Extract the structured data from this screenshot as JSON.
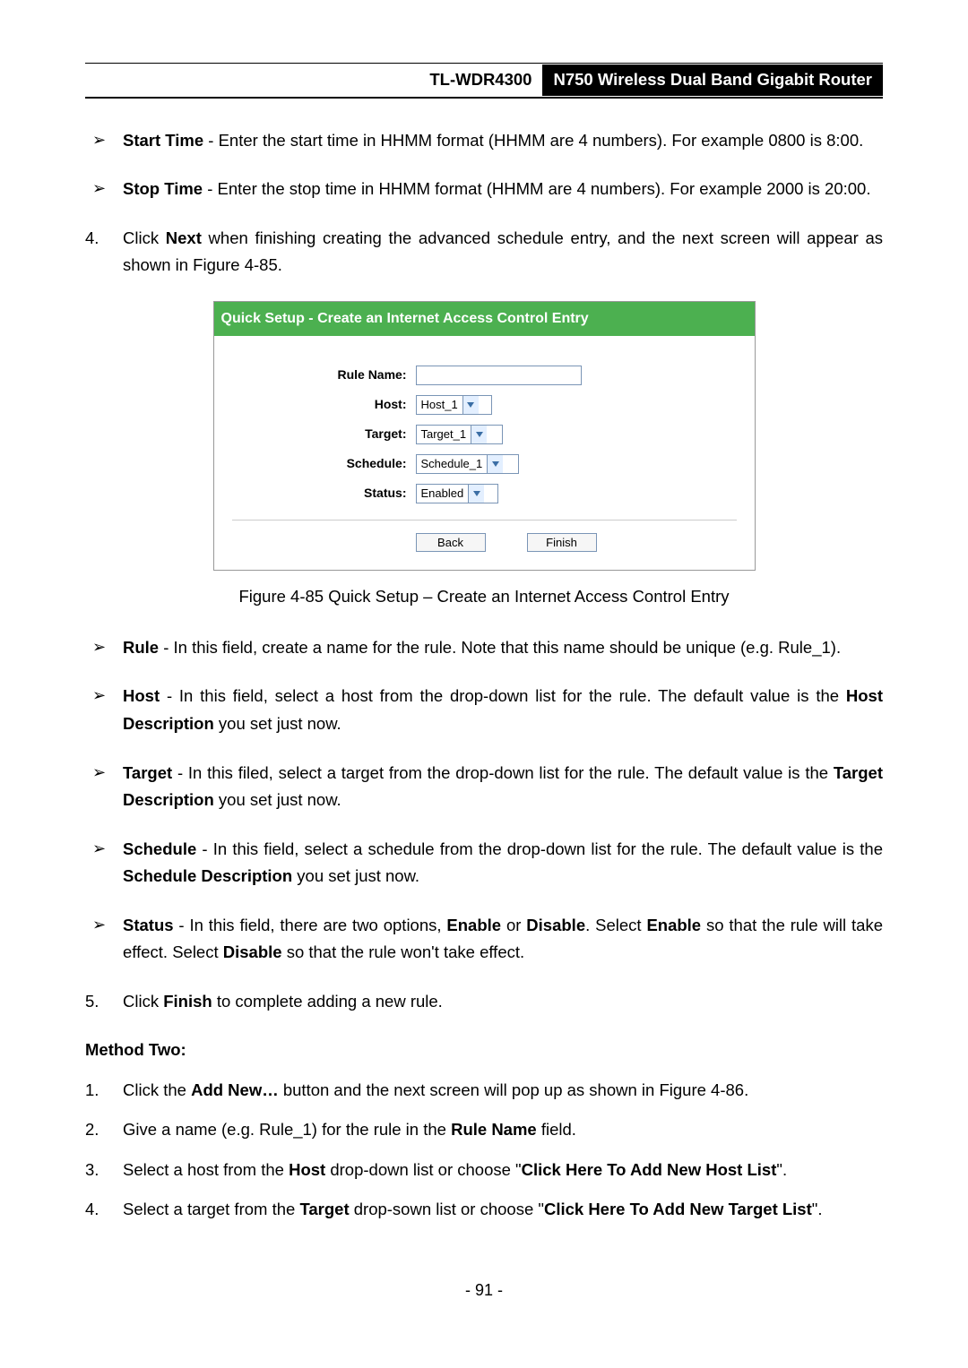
{
  "header": {
    "model": "TL-WDR4300",
    "product": "N750 Wireless Dual Band Gigabit Router"
  },
  "preBullets": [
    {
      "term": "Start Time",
      "rest": " - Enter the start time in HHMM format (HHMM are 4 numbers). For example 0800 is 8:00."
    },
    {
      "term": "Stop Time",
      "rest": " - Enter the stop time in HHMM format (HHMM are 4 numbers). For example 2000 is 20:00."
    }
  ],
  "step4": {
    "num": "4.",
    "pre": "Click ",
    "bold": "Next",
    "post": " when finishing creating the advanced schedule entry, and the next screen will appear as shown in Figure 4-85."
  },
  "figure": {
    "title": "Quick Setup - Create an Internet Access Control Entry",
    "labels": {
      "rule": "Rule Name:",
      "host": "Host:",
      "target": "Target:",
      "schedule": "Schedule:",
      "status": "Status:"
    },
    "values": {
      "rule": "",
      "host": "Host_1",
      "target": "Target_1",
      "schedule": "Schedule_1",
      "status": "Enabled"
    },
    "buttons": {
      "back": "Back",
      "finish": "Finish"
    },
    "caption": "Figure 4-85 Quick Setup – Create an Internet Access Control Entry"
  },
  "postFigBullets": {
    "rule": {
      "term": "Rule",
      "rest": " - In this field, create a name for the rule. Note that this name should be unique (e.g. Rule_1)."
    },
    "hostA": {
      "term": "Host",
      "restA": " - In this field, select a host from the drop-down list for the rule. The default value is the ",
      "bold": "Host Description",
      "restB": " you set just now."
    },
    "target": {
      "term": "Target",
      "restA": " - In this filed, select a target from the drop-down list for the rule. The default value is the ",
      "bold": "Target Description",
      "restB": " you set just now."
    },
    "sched": {
      "term": "Schedule",
      "restA": " - In this field, select a schedule from the drop-down list for the rule. The default value is the ",
      "bold": "Schedule Description",
      "restB": " you set just now."
    },
    "status": {
      "term": "Status",
      "a": " - In this field, there are two options, ",
      "b1": "Enable",
      "c": " or ",
      "b2": "Disable",
      "d": ". Select ",
      "b3": "Enable",
      "e": " so that the rule will take effect. Select ",
      "b4": "Disable",
      "f": " so that the rule won't take effect."
    }
  },
  "step5": {
    "num": "5.",
    "a": "Click ",
    "b": "Finish",
    "c": " to complete adding a new rule."
  },
  "methodTwo": "Method Two:",
  "m2": {
    "i1": {
      "n": "1.",
      "a": "Click the ",
      "b": "Add New…",
      "c": " button and the next screen will pop up as shown in Figure 4-86."
    },
    "i2": {
      "n": "2.",
      "a": "Give a name (e.g. Rule_1) for the rule in the ",
      "b": "Rule Name",
      "c": " field."
    },
    "i3": {
      "n": "3.",
      "a": "Select a host from the ",
      "b": "Host",
      "c": " drop-down list or choose \"",
      "d": "Click Here To Add New Host List",
      "e": "\"."
    },
    "i4": {
      "n": "4.",
      "a": "Select a target from the ",
      "b": "Target",
      "c": " drop-sown list or choose \"",
      "d": "Click Here To Add New Target List",
      "e": "\"."
    }
  },
  "pageNum": "- 91 -"
}
